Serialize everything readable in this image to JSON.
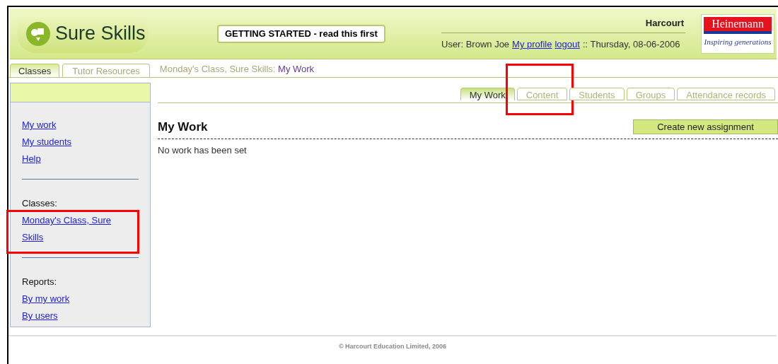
{
  "header": {
    "logo_text": "Sure Skills",
    "getting_started": "GETTING STARTED - read this first",
    "organisation": "Harcourt",
    "user_label": "User: Brown Joe",
    "profile_link": "My profile",
    "logout_link": "logout",
    "date": ":: Thursday, 08-06-2006",
    "brand": {
      "name": "Heinemann",
      "tagline": "Inspiring generations"
    }
  },
  "top_tabs": [
    {
      "label": "Classes",
      "selected": true
    },
    {
      "label": "Tutor Resources",
      "selected": false
    }
  ],
  "breadcrumb": {
    "path": "Monday's Class, Sure Skills:",
    "current": "My Work"
  },
  "sidebar": {
    "links": [
      "My work",
      "My students",
      "Help"
    ],
    "sections": [
      {
        "heading": "Classes:",
        "links": [
          "Monday's Class, Sure Skills"
        ],
        "highlighted": true
      },
      {
        "heading": "Reports:",
        "links": [
          "By my work",
          "By users"
        ],
        "highlighted": false
      }
    ]
  },
  "content_tabs": [
    {
      "label": "My Work",
      "selected": true,
      "highlighted": false
    },
    {
      "label": "Content",
      "selected": false,
      "highlighted": true
    },
    {
      "label": "Students",
      "selected": false,
      "highlighted": false
    },
    {
      "label": "Groups",
      "selected": false,
      "highlighted": false
    },
    {
      "label": "Attendance records",
      "selected": false,
      "highlighted": false
    }
  ],
  "main": {
    "title": "My Work",
    "action_button": "Create new assignment",
    "message": "No work has been set"
  },
  "footer": "© Harcourt Education Limited, 2006"
}
